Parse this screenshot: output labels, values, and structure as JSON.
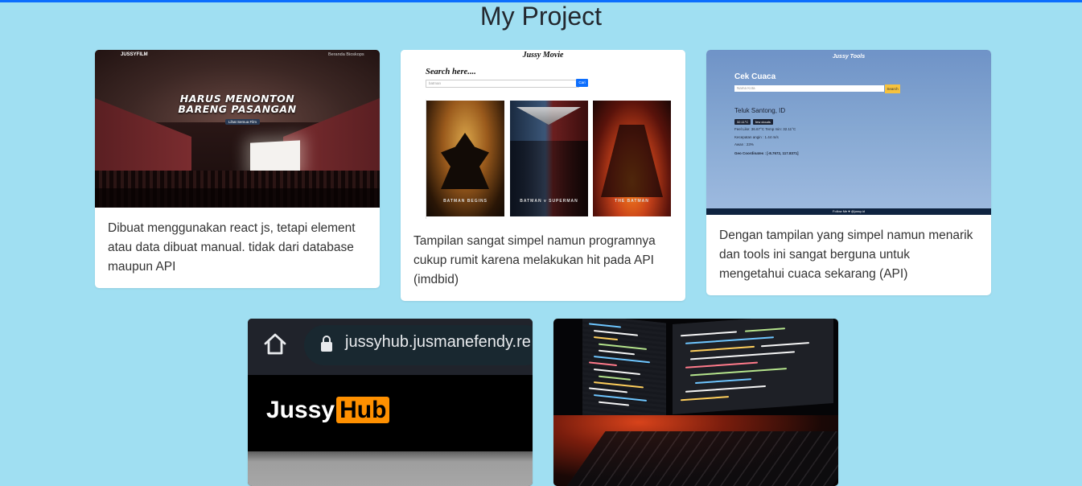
{
  "page": {
    "title": "My Project",
    "accent_color": "#0d6efd",
    "background": "#a0dff2"
  },
  "cards": [
    {
      "description": "Dibuat menggunakan react js, tetapi element atau data dibuat manual. tidak dari database maupun API",
      "screenshot": {
        "brand": "JUSSYFILM",
        "nav": "Beranda   Bioskops",
        "headline_1": "HARUS MENONTON",
        "headline_2": "BARENG PASANGAN",
        "button": "Lihat Semua Film"
      }
    },
    {
      "description": "Tampilan sangat simpel namun programnya cukup rumit karena melakukan hit pada API (imdbid)",
      "screenshot": {
        "title": "Jussy Movie",
        "search_label": "Search here....",
        "input_value": "batman",
        "button": "Cari",
        "posters": [
          "BATMAN BEGINS",
          "BATMAN v SUPERMAN",
          "THE BATMAN"
        ]
      }
    },
    {
      "description": "Dengan tampilan yang simpel namun menarik dan tools ini sangat berguna untuk mengetahui cuaca sekarang (API)",
      "screenshot": {
        "title": "Jussy Tools",
        "heading": "Cek Cuaca",
        "input_placeholder": "Nama Kota",
        "button": "Search",
        "location": "Teluk Santong, ID",
        "chips": [
          "32.11°C",
          "few clouds"
        ],
        "line_1": "Feel Like: 36.67°C  Temp min: 32.11°C",
        "line_2": "Kecepatan angin : 1.44 m/s",
        "line_3": "Awan : 23%",
        "line_4": "Geo Coordinates : [-8.7672, 117.8371]",
        "footer": "Follow Me ♥ @jussy.id"
      }
    },
    {
      "screenshot": {
        "url": "jussyhub.jusmanefendy.re",
        "logo_text": "Jussy",
        "logo_badge": "Hub"
      }
    },
    {
      "screenshot": {
        "subject": "code-on-monitors-photo"
      }
    }
  ]
}
